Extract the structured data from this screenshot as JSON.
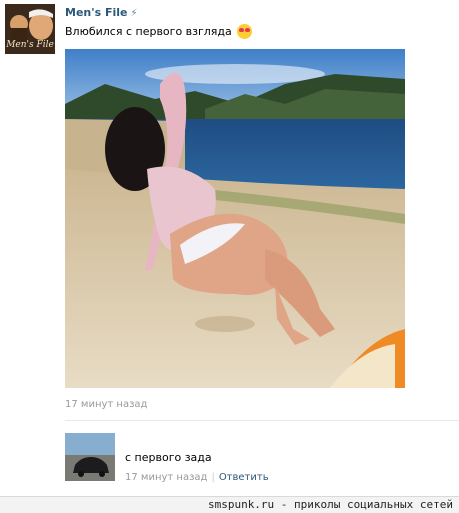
{
  "post": {
    "author": "Men's File",
    "verified_icon": "lightning-icon",
    "text": "Влюбился с первого взгляда",
    "emoji": "heart-eyes-emoji",
    "avatar_caption": "Men's File",
    "timestamp": "17 минут назад"
  },
  "comment": {
    "text": "с первого зада",
    "timestamp": "17 минут назад",
    "separator": "|",
    "reply_label": "Ответить"
  },
  "footer": {
    "watermark": "smspunk.ru - приколы социальных сетей"
  },
  "colors": {
    "link": "#2b587a",
    "meta": "#999999"
  }
}
